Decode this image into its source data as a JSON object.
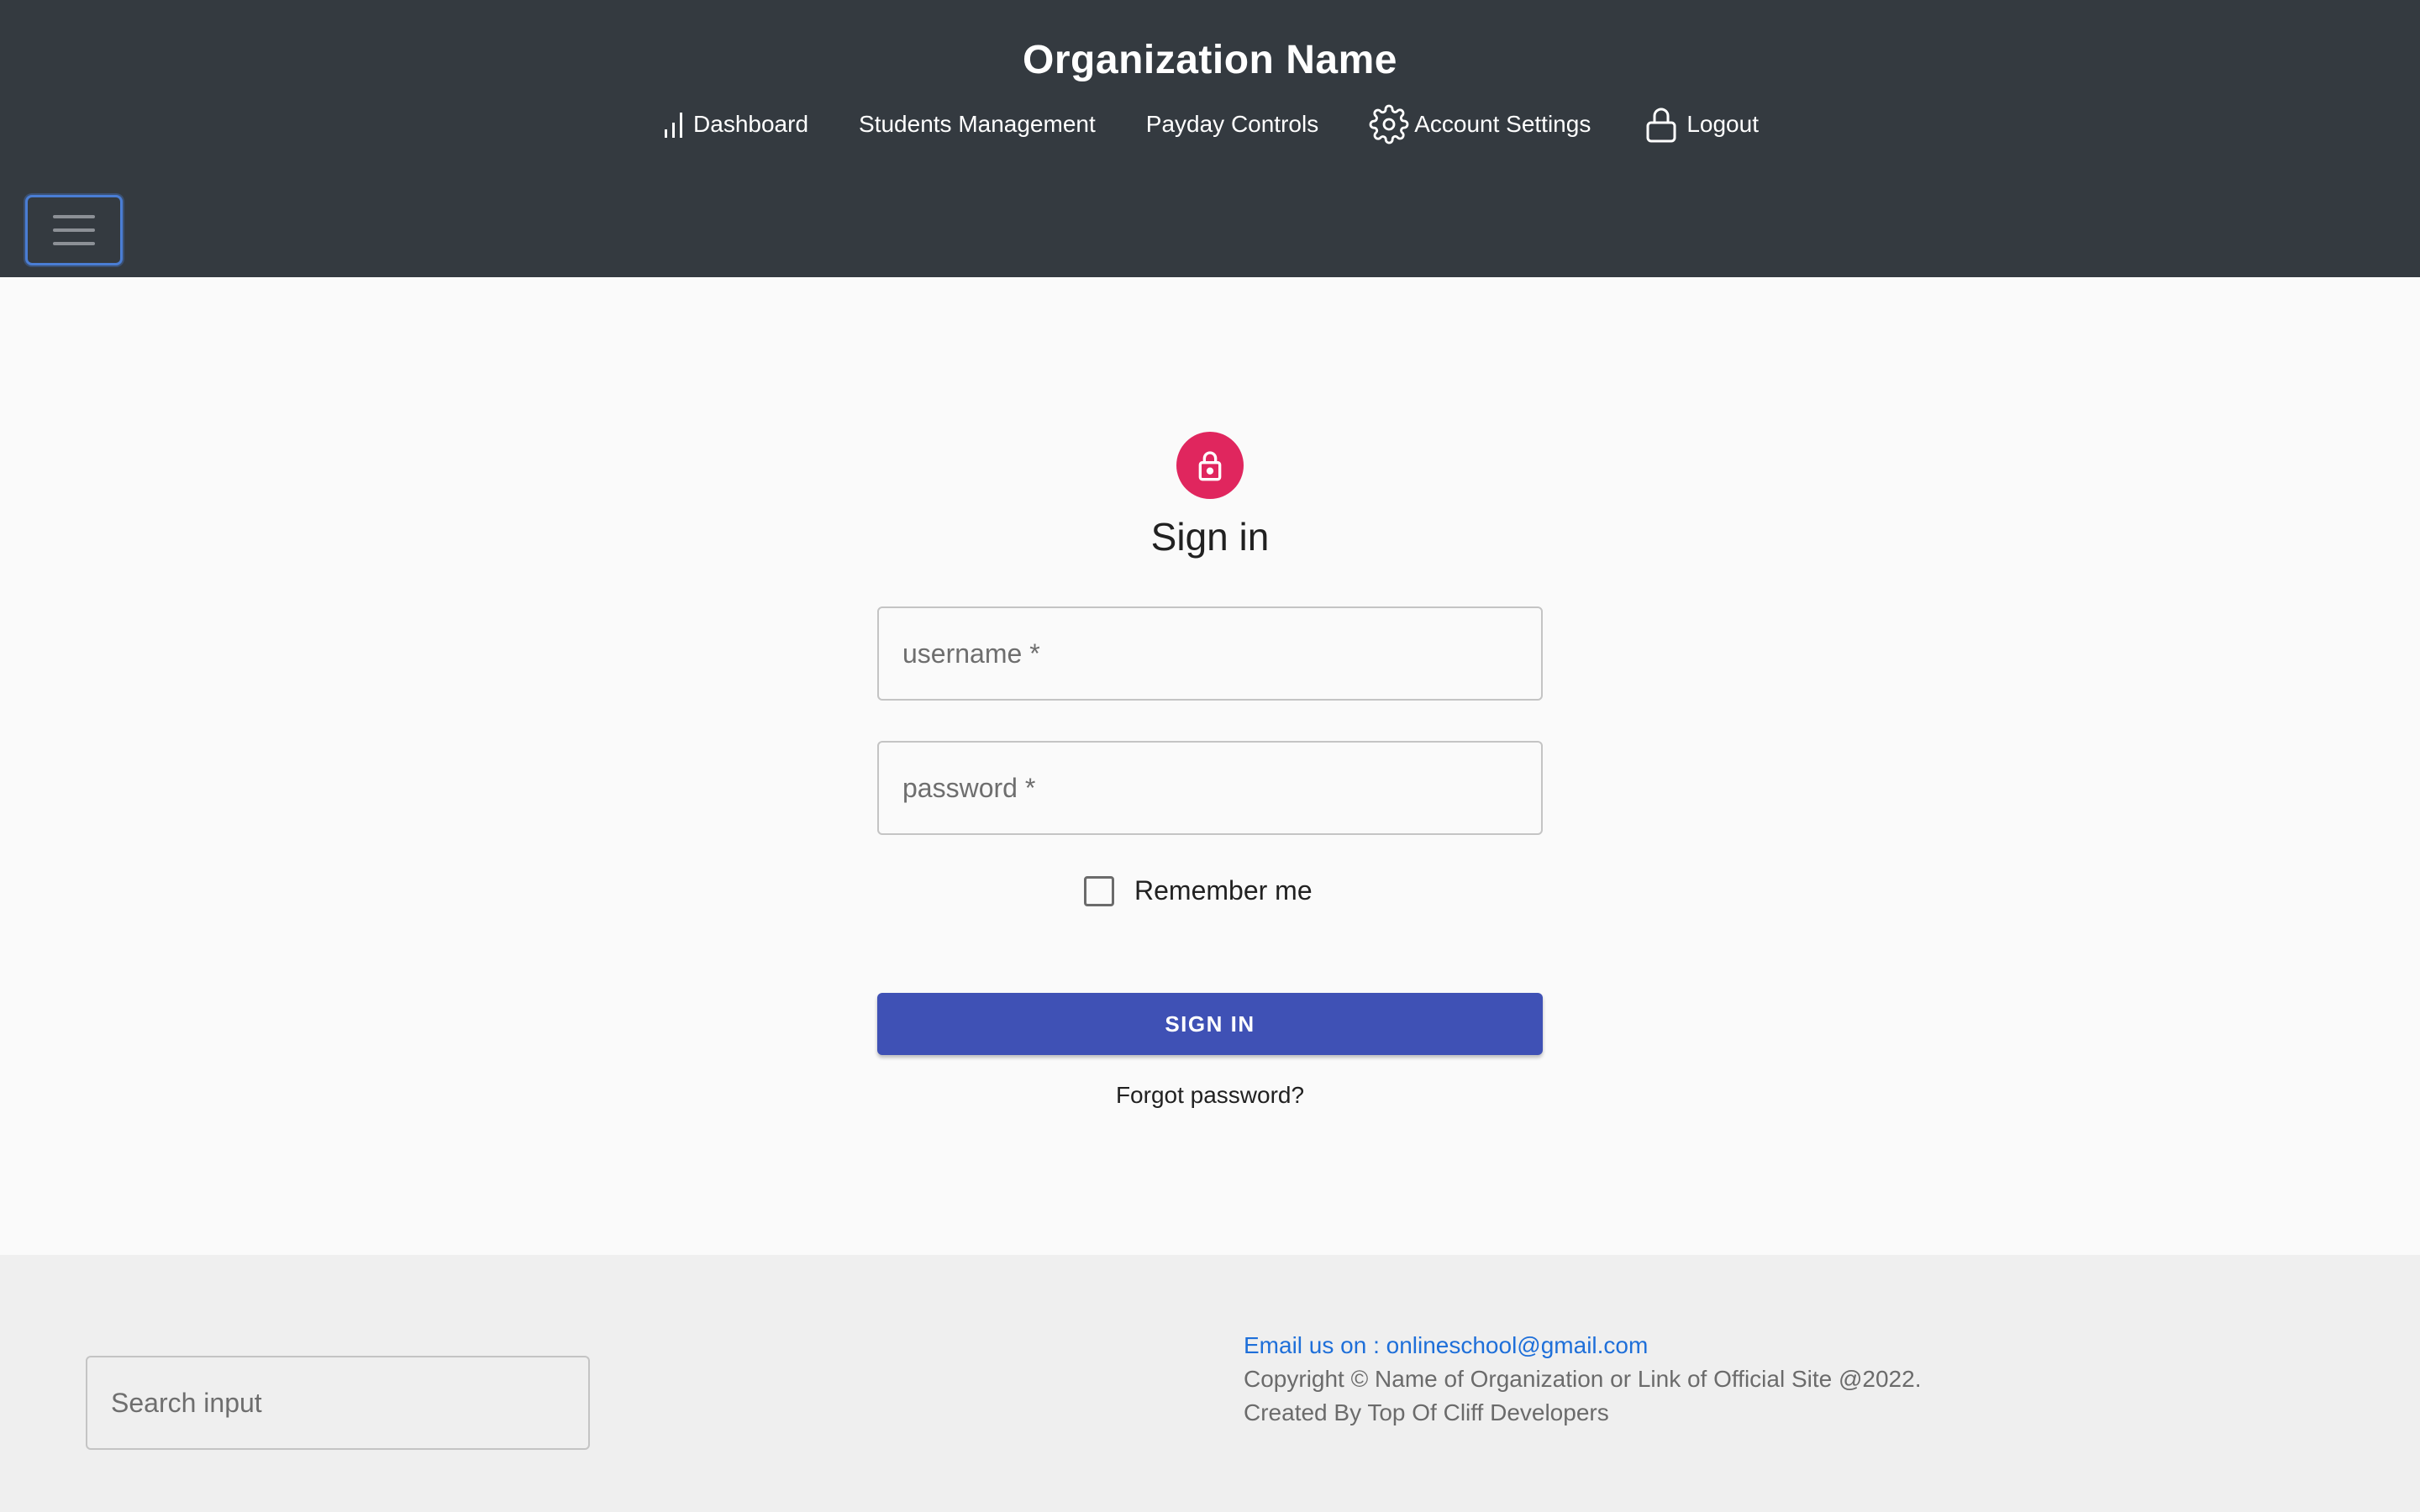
{
  "header": {
    "org_name": "Organization Name",
    "nav": {
      "dashboard": "Dashboard",
      "students": "Students Management",
      "payday": "Payday Controls",
      "account": "Account Settings",
      "logout": "Logout"
    },
    "icons": {
      "dashboard": "bar-chart-icon",
      "account": "gear-icon",
      "logout": "lock-icon",
      "menu": "hamburger-icon"
    },
    "colors": {
      "bg": "#343a40",
      "text": "#ffffff",
      "toggler_border": "#4a7dd4"
    }
  },
  "login": {
    "title": "Sign in",
    "avatar_icon": "lock-open-icon",
    "avatar_color": "#e0265e",
    "username_placeholder": "username *",
    "password_placeholder": "password *",
    "remember_label": "Remember me",
    "remember_checked": false,
    "signin_label": "SIGN IN",
    "signin_color": "#3f51b5",
    "forgot_label": "Forgot password?"
  },
  "footer": {
    "search_placeholder": "Search input",
    "email_text": "Email us on : onlineschool@gmail.com",
    "copyright": "Copyright © Name of Organization or Link of Official Site @2022.",
    "created_by": "Created By Top Of Cliff Developers",
    "email_color": "#1e6fd9"
  }
}
